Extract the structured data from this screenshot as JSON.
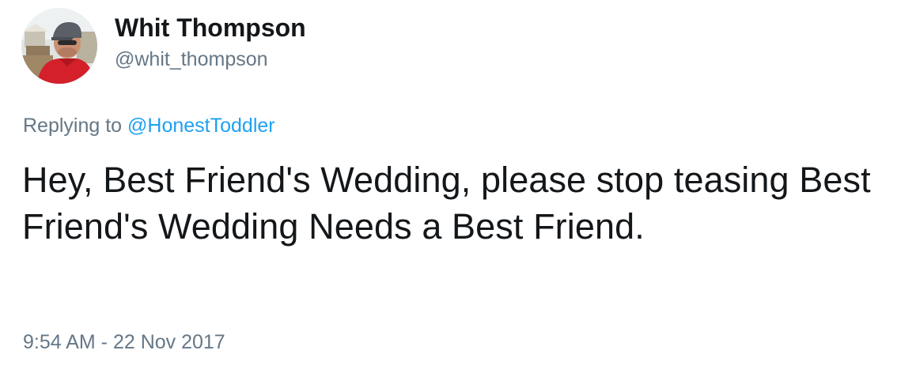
{
  "tweet": {
    "author": {
      "display_name": "Whit Thompson",
      "handle": "@whit_thompson",
      "avatar_icon": "user-avatar-photo"
    },
    "reply": {
      "prefix": "Replying to ",
      "mention": "@HonestToddler"
    },
    "text": "Hey, Best Friend's Wedding, please stop teasing Best Friend's Wedding Needs a Best Friend.",
    "timestamp": "9:54 AM - 22 Nov 2017"
  },
  "colors": {
    "text_primary": "#14171a",
    "text_secondary": "#657786",
    "link": "#1da1f2"
  }
}
